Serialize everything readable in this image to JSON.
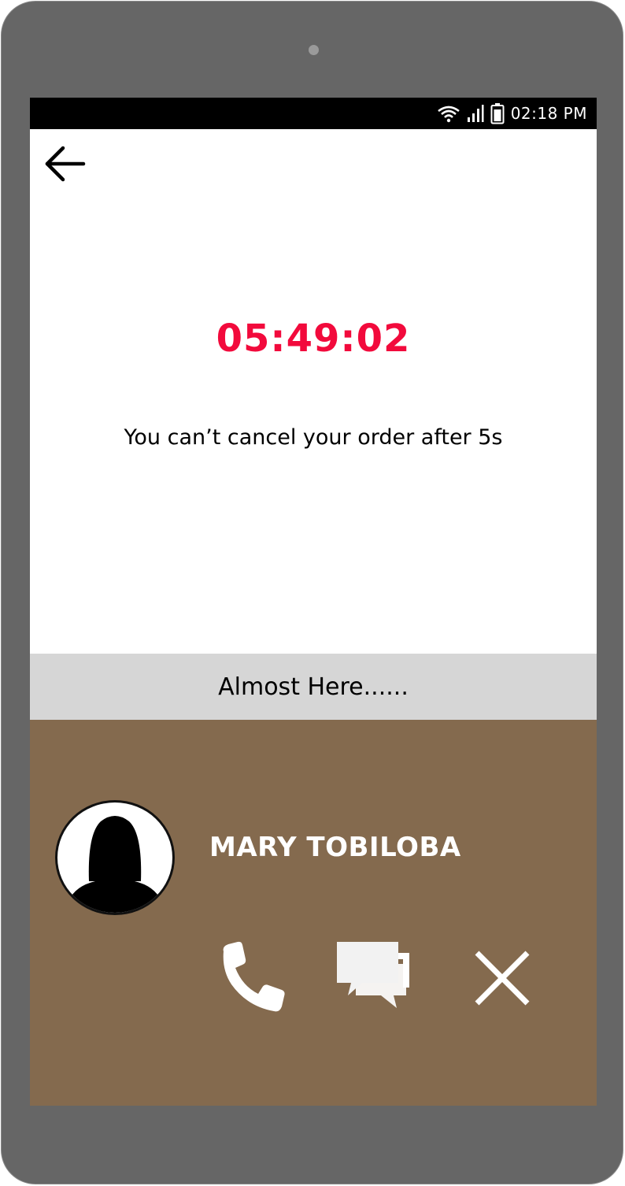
{
  "status_bar": {
    "time": "02:18 PM",
    "icons": [
      "wifi-icon",
      "signal-icon",
      "battery-icon"
    ]
  },
  "header": {
    "back_icon": "arrow-left-icon"
  },
  "countdown": {
    "value": "05:49:02",
    "color": "#f20a3c"
  },
  "notice": {
    "text": "You can’t cancel your order after 5s"
  },
  "progress": {
    "status_text": "Almost Here......"
  },
  "driver": {
    "name": "MARY TOBILOBA",
    "avatar_icon": "female-avatar-icon",
    "actions": [
      {
        "icon": "phone-icon"
      },
      {
        "icon": "chat-icon"
      },
      {
        "icon": "close-icon"
      }
    ]
  },
  "colors": {
    "frame": "#666666",
    "panel": "#846a4e",
    "strip": "#d6d6d6",
    "accent": "#f20a3c"
  }
}
